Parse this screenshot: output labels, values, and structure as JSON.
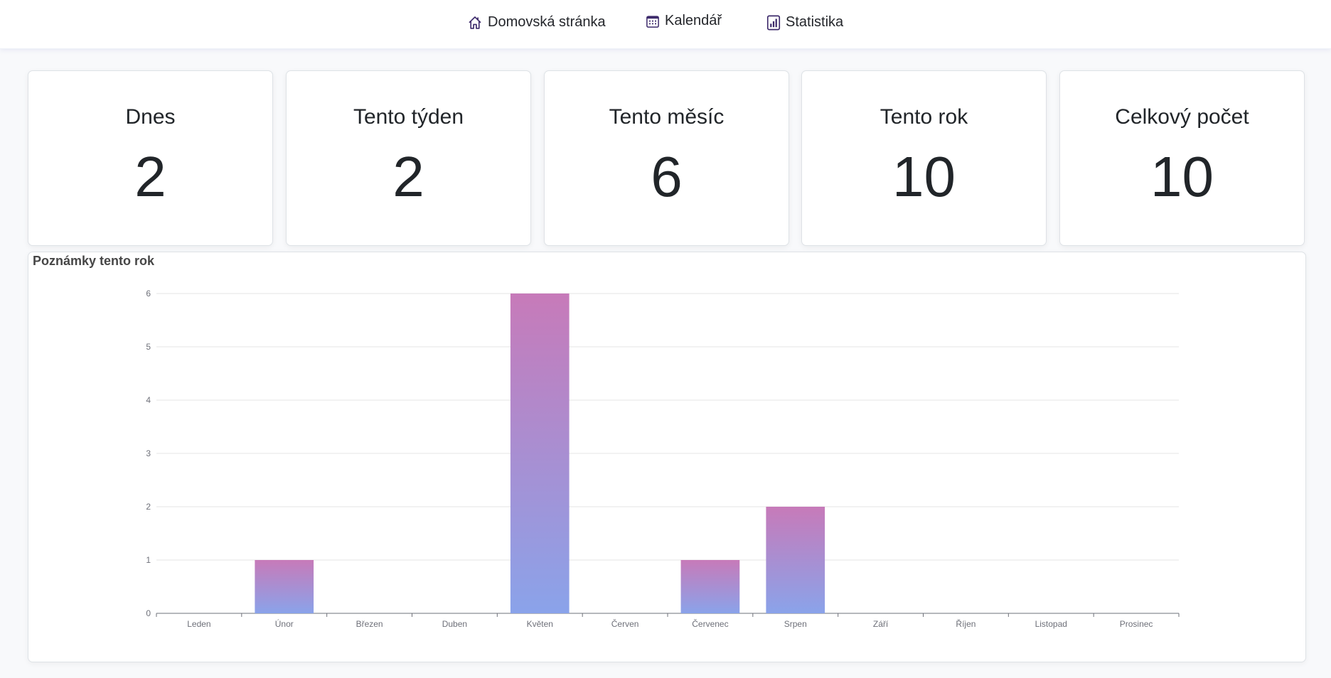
{
  "nav": {
    "items": [
      {
        "label": "Domovská stránka",
        "icon": "home-icon"
      },
      {
        "label": "Kalendář",
        "icon": "calendar-icon"
      },
      {
        "label": "Statistika",
        "icon": "bar-chart-icon"
      }
    ]
  },
  "stats": [
    {
      "label": "Dnes",
      "value": "2"
    },
    {
      "label": "Tento týden",
      "value": "2"
    },
    {
      "label": "Tento měsíc",
      "value": "6"
    },
    {
      "label": "Tento rok",
      "value": "10"
    },
    {
      "label": "Celkový počet",
      "value": "10"
    }
  ],
  "colors": {
    "accent": "#3d2a6b",
    "bar_top": "#c77ab9",
    "bar_bottom": "#8aa3ea"
  },
  "chart_panel": {
    "title": "Poznámky tento rok"
  },
  "chart_data": {
    "type": "bar",
    "title": "Poznámky tento rok",
    "categories": [
      "Leden",
      "Únor",
      "Březen",
      "Duben",
      "Květen",
      "Červen",
      "Červenec",
      "Srpen",
      "Září",
      "Říjen",
      "Listopad",
      "Prosinec"
    ],
    "values": [
      0,
      1,
      0,
      0,
      6,
      0,
      1,
      2,
      0,
      0,
      0,
      0
    ],
    "ylim": [
      0,
      6
    ],
    "yticks": [
      0,
      1,
      2,
      3,
      4,
      5,
      6
    ],
    "grid": true,
    "legend": "none",
    "xlabel": "",
    "ylabel": ""
  }
}
